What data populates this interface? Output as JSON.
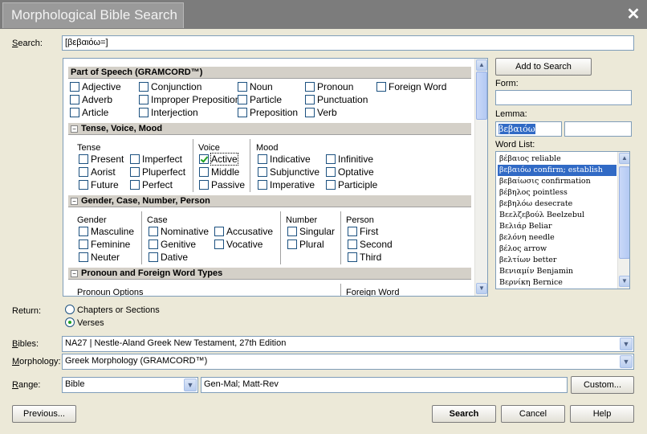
{
  "window": {
    "title": "Morphological Bible Search",
    "close": "✕"
  },
  "search": {
    "label": "Search:",
    "value": "[βεβαιόω=]"
  },
  "sections": {
    "pos": "Part of Speech (GRAMCORD™)",
    "tvm": "Tense, Voice, Mood",
    "gcnp": "Gender, Case, Number, Person",
    "pfw": "Pronoun and Foreign Word Types"
  },
  "pos": [
    "Adjective",
    "Conjunction",
    "Noun",
    "Pronoun",
    "Foreign Word",
    "Adverb",
    "Improper Preposition",
    "Particle",
    "Punctuation",
    "Article",
    "Interjection",
    "Preposition",
    "Verb"
  ],
  "groups": {
    "tense": "Tense",
    "voice": "Voice",
    "mood": "Mood",
    "gender": "Gender",
    "case": "Case",
    "number": "Number",
    "person": "Person",
    "pronoun_options": "Pronoun Options",
    "foreign_word": "Foreign Word"
  },
  "tense": [
    "Present",
    "Imperfect",
    "Aorist",
    "Pluperfect",
    "Future",
    "Perfect"
  ],
  "voice": [
    "Active",
    "Middle",
    "Passive"
  ],
  "mood": [
    "Indicative",
    "Infinitive",
    "Subjunctive",
    "Optative",
    "Imperative",
    "Participle"
  ],
  "gender": [
    "Masculine",
    "Feminine",
    "Neuter"
  ],
  "case": [
    "Nominative",
    "Accusative",
    "Genitive",
    "Vocative",
    "Dative"
  ],
  "number": [
    "Singular",
    "Plural"
  ],
  "person": [
    "First",
    "Second",
    "Third"
  ],
  "right": {
    "add_to_search": "Add to Search",
    "form_label": "Form:",
    "form_value": "",
    "lemma_label": "Lemma:",
    "lemma_value": "βεβαιόω",
    "lemma_extra": "",
    "wordlist_label": "Word List:",
    "words": [
      "βέβαιος reliable",
      "βεβαιόω confirm; establish",
      "βεβαίωσις confirmation",
      "βέβηλος pointless",
      "βεβηλόω desecrate",
      "Βεελζεβούλ Beelzebul",
      "Βελιάρ Beliar",
      "βελόνη needle",
      "βέλος arrow",
      "βελτίων better",
      "Βενιαμίν Benjamin",
      "Βερνίκη Bernice"
    ]
  },
  "return": {
    "label": "Return:",
    "option1": "Chapters or Sections",
    "option2": "Verses"
  },
  "bibles": {
    "label": "Bibles:",
    "value": "NA27 | Nestle-Aland Greek New Testament, 27th Edition"
  },
  "morphology": {
    "label": "Morphology:",
    "value": "Greek Morphology (GRAMCORD™)"
  },
  "range": {
    "label": "Range:",
    "value": "Bible",
    "text": "Gen-Mal; Matt-Rev",
    "custom": "Custom..."
  },
  "buttons": {
    "previous": "Previous...",
    "search": "Search",
    "cancel": "Cancel",
    "help": "Help"
  },
  "colors": {
    "selection": "#316ac5",
    "check": "#21a121",
    "titlebar": "#7c7c7c"
  }
}
